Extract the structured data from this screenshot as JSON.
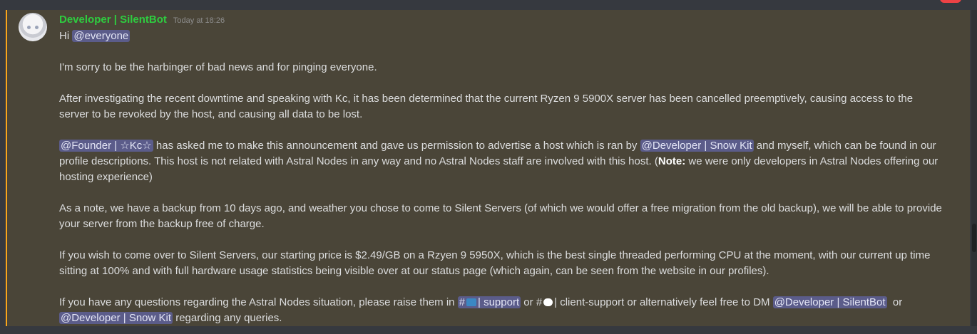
{
  "message": {
    "author": "Developer | SilentBot",
    "timestamp": "Today at 18:26",
    "author_color": "#2ecc40",
    "highlight_color": "#faa61a",
    "line1": {
      "prefix": "Hi ",
      "mention": "@everyone"
    },
    "p1": "I'm sorry to be the harbinger of bad news and for pinging everyone.",
    "p2": "After investigating the recent downtime and speaking with Kc, it has been determined that the current Ryzen 9 5900X server has been cancelled preemptively, causing access to the server to be revoked by the host, and causing all data to be lost.",
    "p3": {
      "mention_founder": "@Founder | ☆Kc☆",
      "text1": " has asked me to make this announcement and gave us permission to advertise a host which is ran by ",
      "mention_snowkit": "@Developer | Snow Kit",
      "text2": " and myself, which can be found in our profile descriptions. This host is not related with Astral Nodes in any way and no Astral Nodes staff are involved with this host. (",
      "note_label": "Note:",
      "text3": " we were only developers in Astral Nodes offering our hosting experience)"
    },
    "p4": "As a note, we have a backup from 10 days ago, and weather you chose to come to Silent Servers (of which we would offer a free migration from the old backup), we will be able to provide your server from the backup free of charge.",
    "p5": "If you wish to come over to Silent Servers, our starting price is $2.49/GB on a Rzyen 9 5950X, which is the best single threaded performing CPU at the moment, with our current up time sitting at 100% and with full hardware usage statistics being visible over at our status page (which again, can be seen from the website in our profiles).",
    "p6": {
      "text1": "If you have any questions regarding the Astral Nodes situation, please raise them in ",
      "channel_support_hash": "#",
      "channel_support_name": "| support",
      "text2": " or ",
      "channel_client_hash": "#",
      "channel_client_name": "| client-support",
      "text3": " or alternatively feel free to DM ",
      "mention_silentbot": "@Developer | SilentBot",
      "text4": "  or ",
      "mention_snowkit": "@Developer | Snow Kit",
      "text5": " regarding any queries."
    }
  }
}
